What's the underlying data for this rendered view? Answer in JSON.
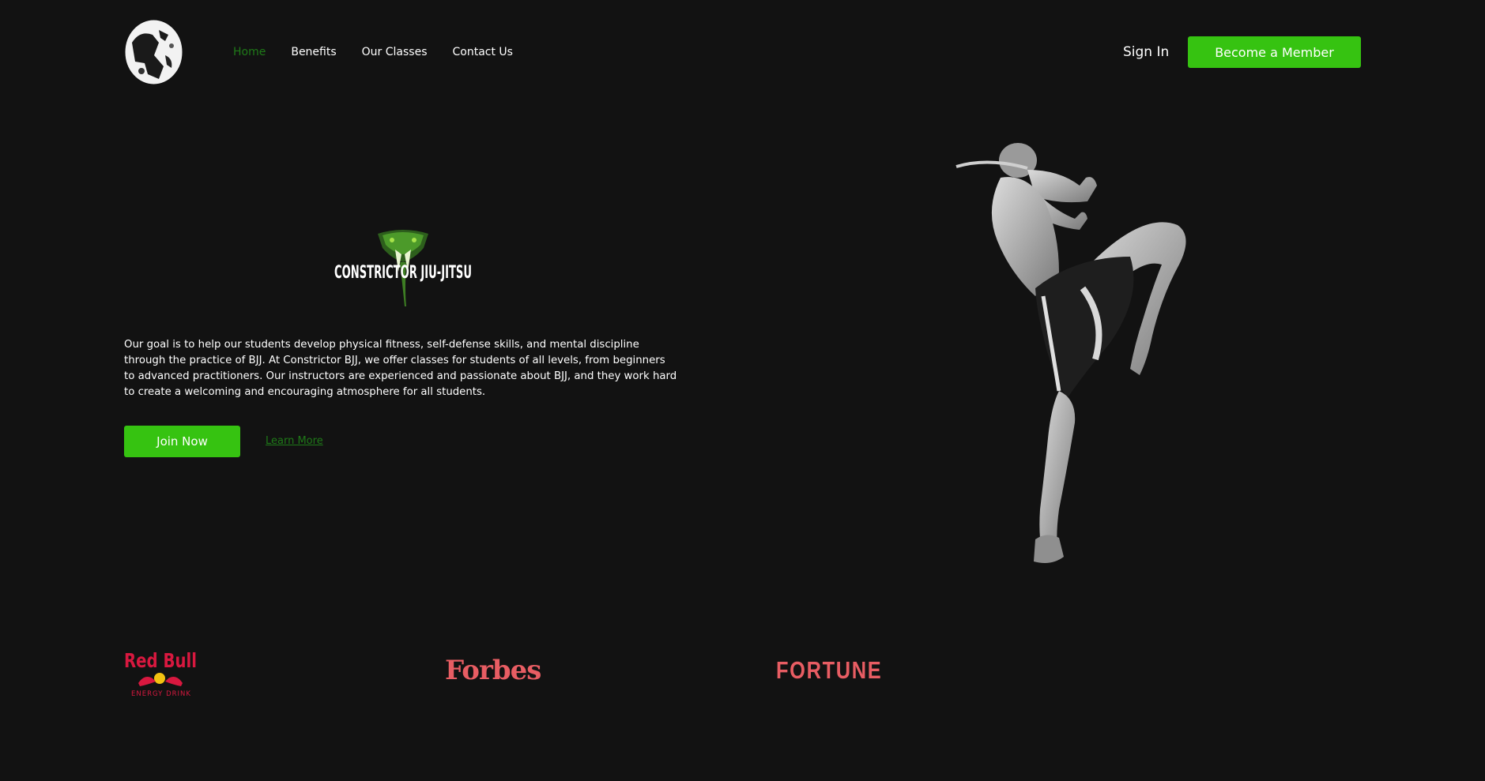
{
  "nav": {
    "items": [
      {
        "label": "Home",
        "active": true
      },
      {
        "label": "Benefits",
        "active": false
      },
      {
        "label": "Our Classes",
        "active": false
      },
      {
        "label": "Contact Us",
        "active": false
      }
    ],
    "sign_in": "Sign In",
    "member_button": "Become a Member"
  },
  "hero": {
    "brand_logo_text": "CONSTRICTOR JIU-JITSU",
    "description": "Our goal is to help our students develop physical fitness, self-defense skills, and mental discipline through the practice of BJJ. At Constrictor BJJ, we offer classes for students of all levels, from beginners to advanced practitioners. Our instructors are experienced and passionate about BJJ, and they work hard to create a welcoming and encouraging atmosphere for all students.",
    "join_button": "Join Now",
    "learn_more": "Learn More"
  },
  "press": {
    "redbull_text": "Red Bull",
    "redbull_sub": "ENERGY DRINK",
    "forbes": "Forbes",
    "fortune": "FORTUNE"
  },
  "colors": {
    "background": "#121212",
    "accent": "#36c311",
    "active_link": "#1f7a18",
    "press_logo": "#e85d63"
  }
}
